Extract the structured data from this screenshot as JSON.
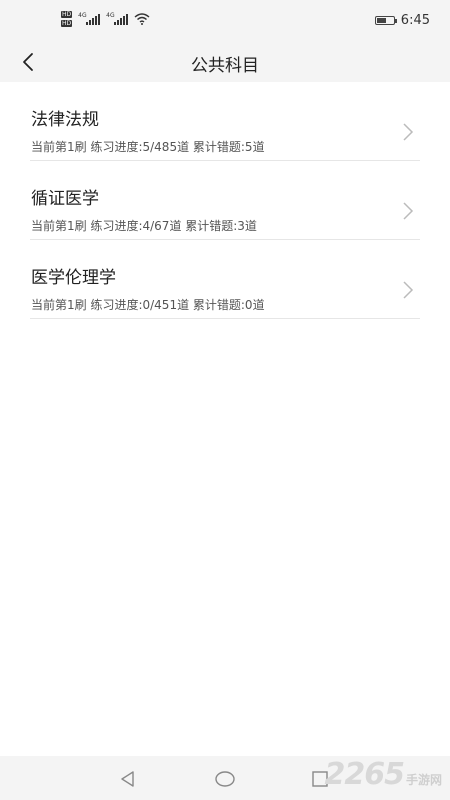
{
  "status_bar": {
    "hd_1": "HD",
    "hd_2": "HD",
    "net_1": "4G",
    "net_2": "4G",
    "time": "6:45",
    "battery_level": 0.55
  },
  "header": {
    "title": "公共科目"
  },
  "subjects": [
    {
      "title": "法律法规",
      "subtitle": "当前第1刷 练习进度:5/485道 累计错题:5道"
    },
    {
      "title": "循证医学",
      "subtitle": "当前第1刷 练习进度:4/67道 累计错题:3道"
    },
    {
      "title": "医学伦理学",
      "subtitle": "当前第1刷 练习进度:0/451道 累计错题:0道"
    }
  ],
  "watermark": {
    "number": "2265",
    "text": "手游网"
  },
  "icons": [
    "back-arrow-icon",
    "chevron-right-icon",
    "nav-back-icon",
    "nav-home-icon",
    "nav-recents-icon",
    "wifi-icon",
    "battery-icon"
  ]
}
